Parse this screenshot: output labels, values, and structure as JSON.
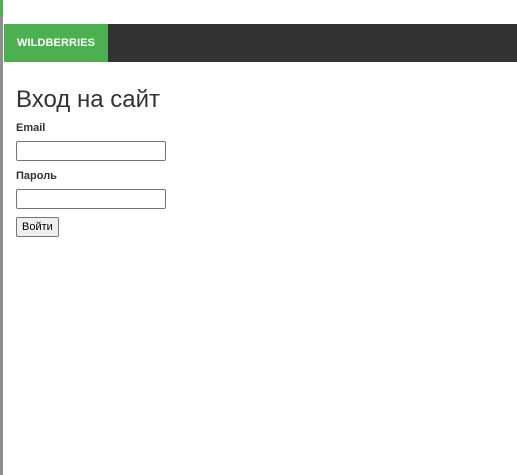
{
  "navbar": {
    "brand": "WILDBERRIES"
  },
  "login": {
    "title": "Вход на сайт",
    "email_label": "Email",
    "email_value": "",
    "password_label": "Пароль",
    "password_value": "",
    "submit_label": "Войти"
  },
  "colors": {
    "brand_bg": "#4caf50",
    "navbar_bg": "#333333"
  }
}
